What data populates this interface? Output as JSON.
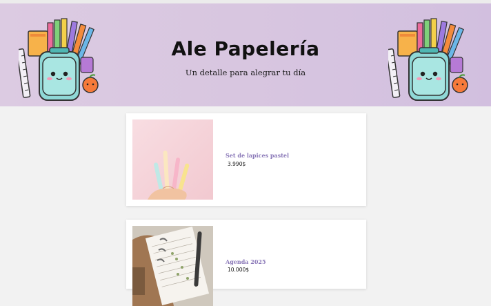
{
  "header": {
    "title": "Ale Papelería",
    "tagline": "Un detalle para alegrar tu día"
  },
  "products": [
    {
      "name": "Set de lapices pastel",
      "price": "3.990$"
    },
    {
      "name": "Agenda 2025",
      "price": "10.000$"
    }
  ],
  "icons": {
    "banner_art": "school-supplies-backpack-icon",
    "product1": "pastel-pens-photo",
    "product2": "planner-agenda-photo"
  },
  "colors": {
    "banner": "#d8c6e0",
    "product_name": "#8a78b8",
    "background": "#f2f2f2"
  }
}
